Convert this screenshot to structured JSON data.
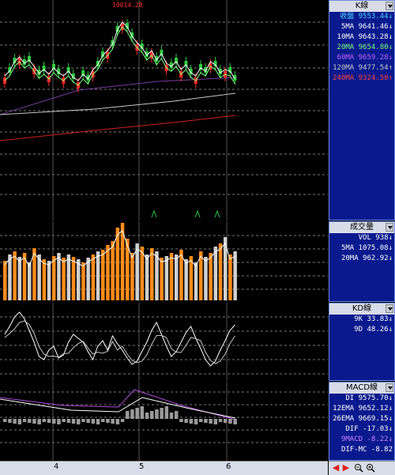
{
  "x_axis": {
    "labels": [
      "4",
      "5",
      "6"
    ]
  },
  "k_panel": {
    "title": "K線",
    "peak_label": "10014.28",
    "rows": [
      {
        "label": "收盤",
        "value": "9553.44",
        "arrow": "↓",
        "color": "#4fd2ff"
      },
      {
        "label": "5MA",
        "value": "9641.46",
        "arrow": "↓",
        "color": "#ffffff"
      },
      {
        "label": "10MA",
        "value": "9643.28",
        "arrow": "↓",
        "color": "#ffffff"
      },
      {
        "label": "20MA",
        "value": "9654.80",
        "arrow": "↓",
        "color": "#7dff7d"
      },
      {
        "label": "60MA",
        "value": "9659.28",
        "arrow": "↓",
        "color": "#c060ff"
      },
      {
        "label": "120MA",
        "value": "9477.54",
        "arrow": "↑",
        "color": "#c8c8c8"
      },
      {
        "label": "240MA",
        "value": "9324.50",
        "arrow": "↑",
        "color": "#ff4040"
      }
    ]
  },
  "vol_panel": {
    "title": "成交量",
    "rows": [
      {
        "label": "VOL",
        "value": "938",
        "arrow": "↓",
        "color": "#ffffff"
      },
      {
        "label": "5MA",
        "value": "1075.08",
        "arrow": "↓",
        "color": "#ffffff"
      },
      {
        "label": "20MA",
        "value": "962.92",
        "arrow": "↓",
        "color": "#ffffff"
      }
    ]
  },
  "kd_panel": {
    "title": "KD線",
    "rows": [
      {
        "label": "9K",
        "value": "33.83",
        "arrow": "↓",
        "color": "#ffffff"
      },
      {
        "label": "9D",
        "value": "48.26",
        "arrow": "↓",
        "color": "#ffffff"
      }
    ]
  },
  "macd_panel": {
    "title": "MACD線",
    "rows": [
      {
        "label": "DI",
        "value": "9575.70",
        "arrow": "↓",
        "color": "#ffffff"
      },
      {
        "label": "12EMA",
        "value": "9652.12",
        "arrow": "↓",
        "color": "#ffffff"
      },
      {
        "label": "26EMA",
        "value": "9669.15",
        "arrow": "↓",
        "color": "#ffffff"
      },
      {
        "label": "DIF",
        "value": "-17.03",
        "arrow": "↓",
        "color": "#ffffff"
      },
      {
        "label": "9MACD",
        "value": "-8.22",
        "arrow": "↓",
        "color": "#d080ff"
      },
      {
        "label": "DIF-MC",
        "value": "-8.82",
        "arrow": "",
        "color": "#ffffff"
      }
    ]
  },
  "colors": {
    "up": "#ff2a2a",
    "down": "#2ecc40",
    "vol_up": "#ff8c1a",
    "vol_down": "#d0d0d0",
    "ma60": "#b04ad8",
    "ma120": "#c8c8c8",
    "ma240": "#d02020"
  },
  "icons": [
    "arrow-left-icon",
    "arrow-right-icon",
    "zoom-out-icon",
    "zoom-in-icon"
  ]
}
